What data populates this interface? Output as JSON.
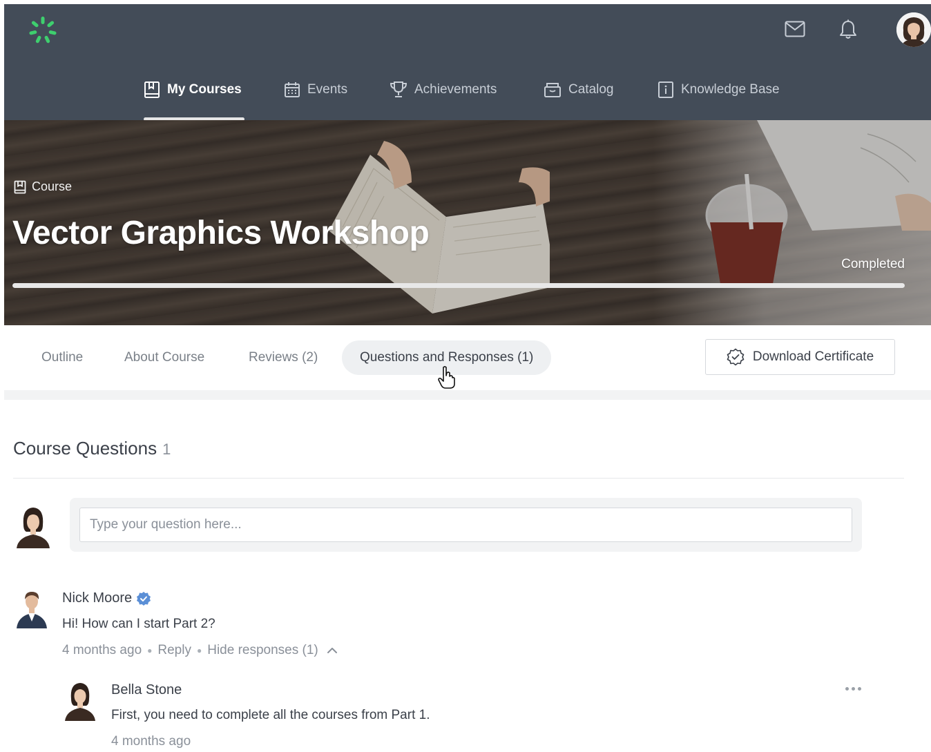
{
  "header": {
    "nav": [
      {
        "label": "My Courses",
        "icon": "book-icon",
        "active": true
      },
      {
        "label": "Events",
        "icon": "calendar-icon",
        "active": false
      },
      {
        "label": "Achievements",
        "icon": "trophy-icon",
        "active": false
      },
      {
        "label": "Catalog",
        "icon": "archive-box-icon",
        "active": false
      },
      {
        "label": "Knowledge Base",
        "icon": "info-book-icon",
        "active": false
      }
    ],
    "icons": [
      "mail-icon",
      "bell-icon",
      "user-avatar"
    ]
  },
  "hero": {
    "breadcrumb": "Course",
    "title": "Vector Graphics Workshop",
    "status": "Completed",
    "progress_percent": 100
  },
  "tabs": [
    {
      "label": "Outline",
      "active": false
    },
    {
      "label": "About Course",
      "active": false
    },
    {
      "label": "Reviews (2)",
      "active": false
    },
    {
      "label": "Questions and Responses (1)",
      "active": true
    }
  ],
  "certificate_button": {
    "label": "Download Certificate",
    "icon": "certificate-badge-icon"
  },
  "questions": {
    "title": "Course Questions",
    "count": "1",
    "input_placeholder": "Type your question here...",
    "items": [
      {
        "author": "Nick Moore",
        "verified": true,
        "text": "Hi! How can I start Part 2?",
        "time": "4 months ago",
        "reply_label": "Reply",
        "hide_label": "Hide responses (1)",
        "responses": [
          {
            "author": "Bella Stone",
            "text": "First, you need to complete all the courses from Part 1.",
            "time": "4 months ago"
          }
        ]
      }
    ]
  },
  "colors": {
    "header_bg": "#434c58",
    "logo_green": "#3ecf6e",
    "verified_blue": "#5b8fd6",
    "active_tab_bg": "#eef0f2"
  }
}
